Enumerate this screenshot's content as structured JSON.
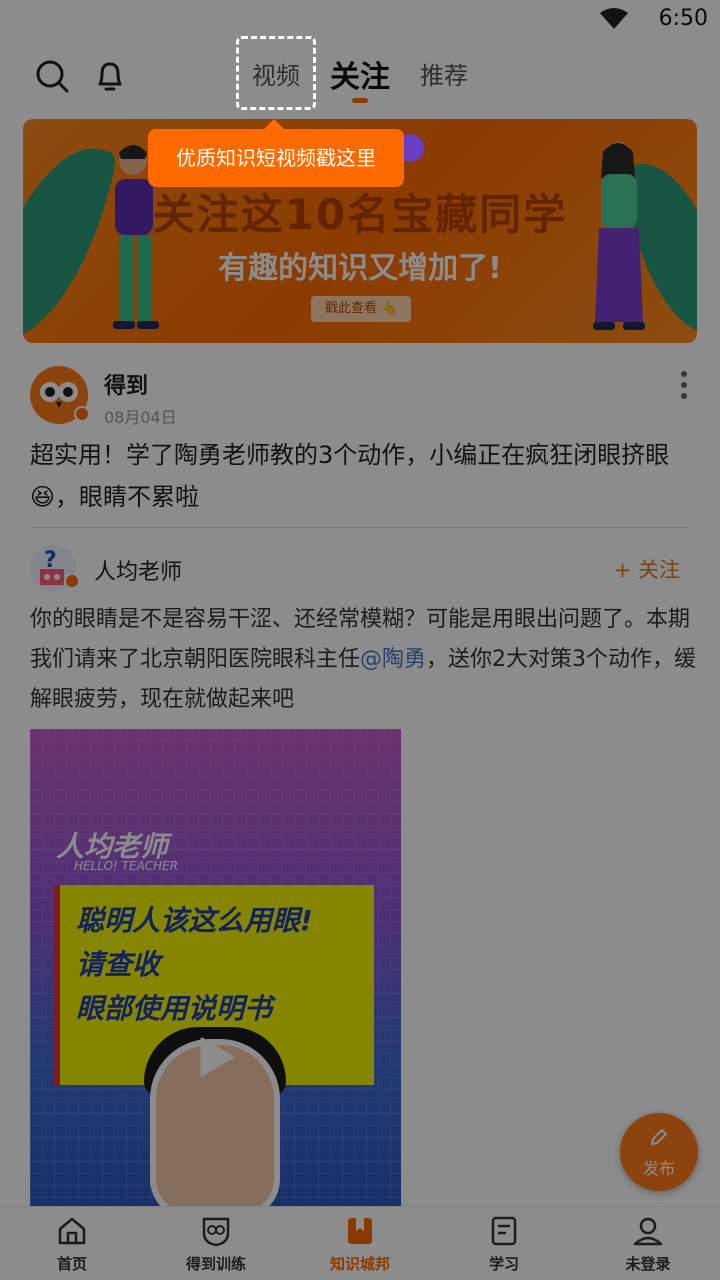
{
  "status_bar": {
    "time": "6:50"
  },
  "top_nav": {
    "tabs": [
      {
        "label": "视频"
      },
      {
        "label": "关注",
        "active": true
      },
      {
        "label": "推荐"
      }
    ]
  },
  "tooltip": {
    "text": "优质知识短视频戳这里"
  },
  "banner": {
    "headline": "关注这10名宝藏同学",
    "subline": "有趣的知识又增加了!",
    "cta": "戳此查看 👆"
  },
  "post": {
    "author": "得到",
    "date": "08月04日",
    "text": "超实用！学了陶勇老师教的3个动作，小编正在疯狂闭眼挤眼😆，眼睛不累啦"
  },
  "quoted": {
    "author": "人均老师",
    "follow_label": "+ 关注",
    "text_before": "你的眼睛是不是容易干涩、还经常模糊？可能是用眼出问题了。本期我们请来了北京朝阳医院眼科主任",
    "mention": "@陶勇",
    "text_after": "，送你2大对策3个动作，缓解眼疲劳，现在就做起来吧",
    "video": {
      "brand": "人均老师",
      "brand_sub": "HELLO! TEACHER",
      "lines": [
        "聪明人该这么用眼!",
        "请查收",
        "眼部使用说明书"
      ]
    }
  },
  "fab": {
    "label": "发布"
  },
  "bottom_nav": {
    "items": [
      {
        "label": "首页",
        "icon": "home-icon"
      },
      {
        "label": "得到训练",
        "icon": "owl-shield-icon"
      },
      {
        "label": "知识城邦",
        "icon": "bookmark-book-icon",
        "active": true
      },
      {
        "label": "学习",
        "icon": "document-icon"
      },
      {
        "label": "未登录",
        "icon": "person-icon"
      }
    ]
  },
  "colors": {
    "accent": "#ff6a00",
    "mention": "#4a76c8",
    "follow": "#e07a1a"
  }
}
